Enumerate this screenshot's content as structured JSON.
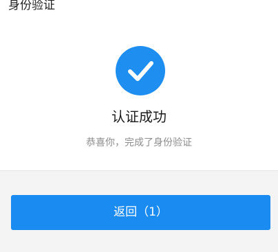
{
  "header": {
    "title": "身份验证"
  },
  "result": {
    "icon": "checkmark-circle-icon",
    "title": "认证成功",
    "subtitle": "恭喜你，完成了身份验证"
  },
  "actions": {
    "return_label": "返回（1）"
  },
  "colors": {
    "accent": "#1a8bf0",
    "footer_background": "#f4f4f4"
  }
}
